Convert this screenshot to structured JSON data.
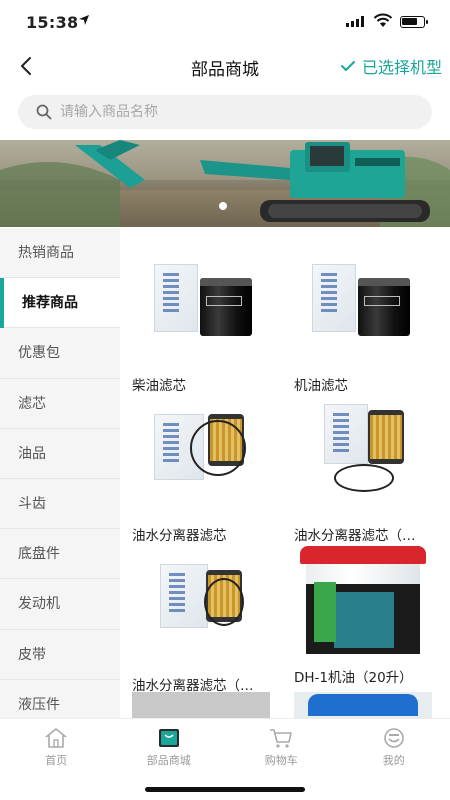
{
  "status_bar": {
    "time": "15:38"
  },
  "header": {
    "title": "部品商城",
    "machine_label": "已选择机型"
  },
  "search": {
    "placeholder": "请输入商品名称"
  },
  "sidebar": {
    "items": [
      {
        "label": "热销商品",
        "active": false
      },
      {
        "label": "推荐商品",
        "active": true
      },
      {
        "label": "优惠包",
        "active": false
      },
      {
        "label": "滤芯",
        "active": false
      },
      {
        "label": "油品",
        "active": false
      },
      {
        "label": "斗齿",
        "active": false
      },
      {
        "label": "底盘件",
        "active": false
      },
      {
        "label": "发动机",
        "active": false
      },
      {
        "label": "皮带",
        "active": false
      },
      {
        "label": "液压件",
        "active": false
      }
    ]
  },
  "products": [
    {
      "name": "柴油滤芯",
      "icon": "filter-canister-image"
    },
    {
      "name": "机油滤芯",
      "icon": "filter-canister-image"
    },
    {
      "name": "油水分离器滤芯",
      "icon": "filter-element-image"
    },
    {
      "name": "油水分离器滤芯（…",
      "icon": "filter-element-image"
    },
    {
      "name": "油水分离器滤芯（…",
      "icon": "filter-element-image"
    },
    {
      "name": "DH-1机油（20升）",
      "icon": "oil-bucket-image"
    }
  ],
  "tabbar": {
    "items": [
      {
        "label": "首页",
        "icon": "home-icon",
        "active": false
      },
      {
        "label": "部品商城",
        "icon": "shop-icon",
        "active": true
      },
      {
        "label": "购物车",
        "icon": "cart-icon",
        "active": false
      },
      {
        "label": "我的",
        "icon": "profile-icon",
        "active": false
      }
    ]
  },
  "colors": {
    "accent": "#1aa69a",
    "sidebar_bg": "#f5f5f5"
  }
}
